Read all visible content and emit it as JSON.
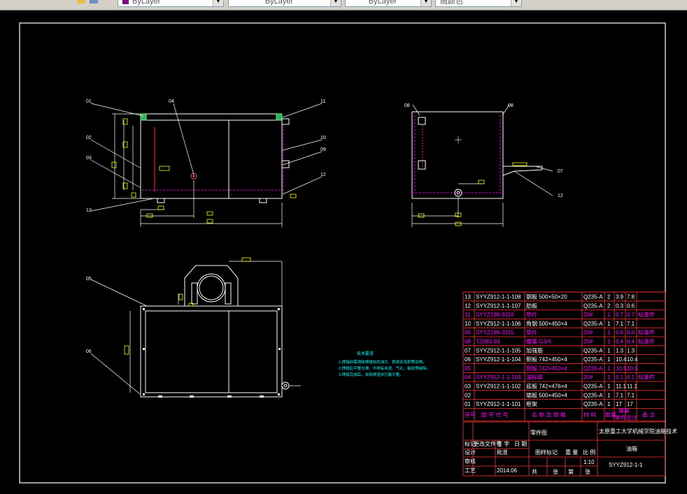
{
  "toolbar": {
    "layer_props_a": "ByLayer",
    "layer_props_b": "ByLayer",
    "layer_props_c": "ByLayer",
    "layer_props_d": "随颜色"
  },
  "drawing": {
    "balloons": [
      "01",
      "02",
      "03",
      "04",
      "11",
      "10",
      "09",
      "13",
      "08",
      "08",
      "12",
      "05",
      "06",
      "07",
      "12"
    ],
    "notes_title": "技术要求",
    "notes": [
      "1.焊接前需清除焊缝处的油污、铁锈及毛刺等杂物。",
      "2.焊缝应平整光滑，不得有夹渣、气孔、裂纹等缺陷。",
      "3.焊接完成后，去除焊渣并打磨平整。"
    ]
  },
  "bom": {
    "rows": [
      {
        "no": "13",
        "code": "SYYZ912-1-1-108",
        "name": "钢板 500×50×20",
        "mat": "Q235-A",
        "qty": "2",
        "w1": "3.9",
        "w2": "7.8",
        "note": ""
      },
      {
        "no": "12",
        "code": "SYYZ912-1-1-107",
        "name": "肋板",
        "mat": "Q235-A",
        "qty": "2",
        "w1": "0.3",
        "w2": "0.6",
        "note": ""
      },
      {
        "no": "11",
        "code": "SYYZ189-3316",
        "name": "垫片",
        "mat": "20#",
        "qty": "1",
        "w1": "0.7",
        "w2": "0.7",
        "note": "标准件"
      },
      {
        "no": "10",
        "code": "SYYZ912-1-1-106",
        "name": "角钢 500×450×4",
        "mat": "Q235-A",
        "qty": "1",
        "w1": "7.1",
        "w2": "7.1",
        "note": ""
      },
      {
        "no": "09",
        "code": "SYYZ189-3315",
        "name": "垫片",
        "mat": "20#",
        "qty": "1",
        "w1": "0.6",
        "w2": "0.6",
        "note": "标准件"
      },
      {
        "no": "08",
        "code": "TZ083-93",
        "name": "螺塞 G3/4",
        "mat": "20#",
        "qty": "1",
        "w1": "0.4",
        "w2": "0.4",
        "note": "标准件"
      },
      {
        "no": "07",
        "code": "SYYZ912-1-1-105",
        "name": "加强筋",
        "mat": "Q235-A",
        "qty": "1",
        "w1": "1.3",
        "w2": "1.3",
        "note": ""
      },
      {
        "no": "06",
        "code": "SYYZ912-1-1-104",
        "name": "侧板 742×450×4",
        "mat": "Q235-A",
        "qty": "1",
        "w1": "10.4",
        "w2": "10.4",
        "note": ""
      },
      {
        "no": "05",
        "code": "",
        "name": "侧板 742×450×4",
        "mat": "Q235-A",
        "qty": "1",
        "w1": "10.5",
        "w2": "10.5",
        "note": ""
      },
      {
        "no": "04",
        "code": "SYYZ912-1-1-103",
        "name": "油标座",
        "mat": "20#",
        "qty": "1",
        "w1": "0.1",
        "w2": "0.1",
        "note": "标准件"
      },
      {
        "no": "03",
        "code": "SYYZ912-1-1-102",
        "name": "底板 742×476×4",
        "mat": "Q235-A",
        "qty": "1",
        "w1": "11.1",
        "w2": "11.1",
        "note": ""
      },
      {
        "no": "02",
        "code": "",
        "name": "端板 500×450×4",
        "mat": "Q235-A",
        "qty": "1",
        "w1": "7.1",
        "w2": "7.1",
        "note": ""
      },
      {
        "no": "01",
        "code": "SYYZ912-1-1-101",
        "name": "框架",
        "mat": "Q235-A",
        "qty": "1",
        "w1": "17",
        "w2": "17",
        "note": ""
      }
    ],
    "header": {
      "no": "序号",
      "code": "图 号 代 号",
      "name": "名 称 及 规 格",
      "mat": "材 料",
      "qty": "数量",
      "w1": "单件",
      "w2": "总计",
      "w_label": "重量",
      "note": "备 注"
    }
  },
  "title_block": {
    "drawing_name": "零件图",
    "company": "太原重工大学机械学院油箱技术",
    "part": "油箱",
    "code": "SYYZ912-1-1",
    "scale_label": "比 例",
    "scale": "1:10",
    "weight_label": "重 量",
    "stage_label": "图样标记",
    "sheet_total": "共",
    "sheet_label": "张",
    "page": "第",
    "page_label": "张",
    "date": "2014.06",
    "roles": [
      "标记",
      "处数",
      "更改文件号",
      "签 字",
      "日 期",
      "设计",
      "审核",
      "工艺",
      "批准"
    ]
  }
}
